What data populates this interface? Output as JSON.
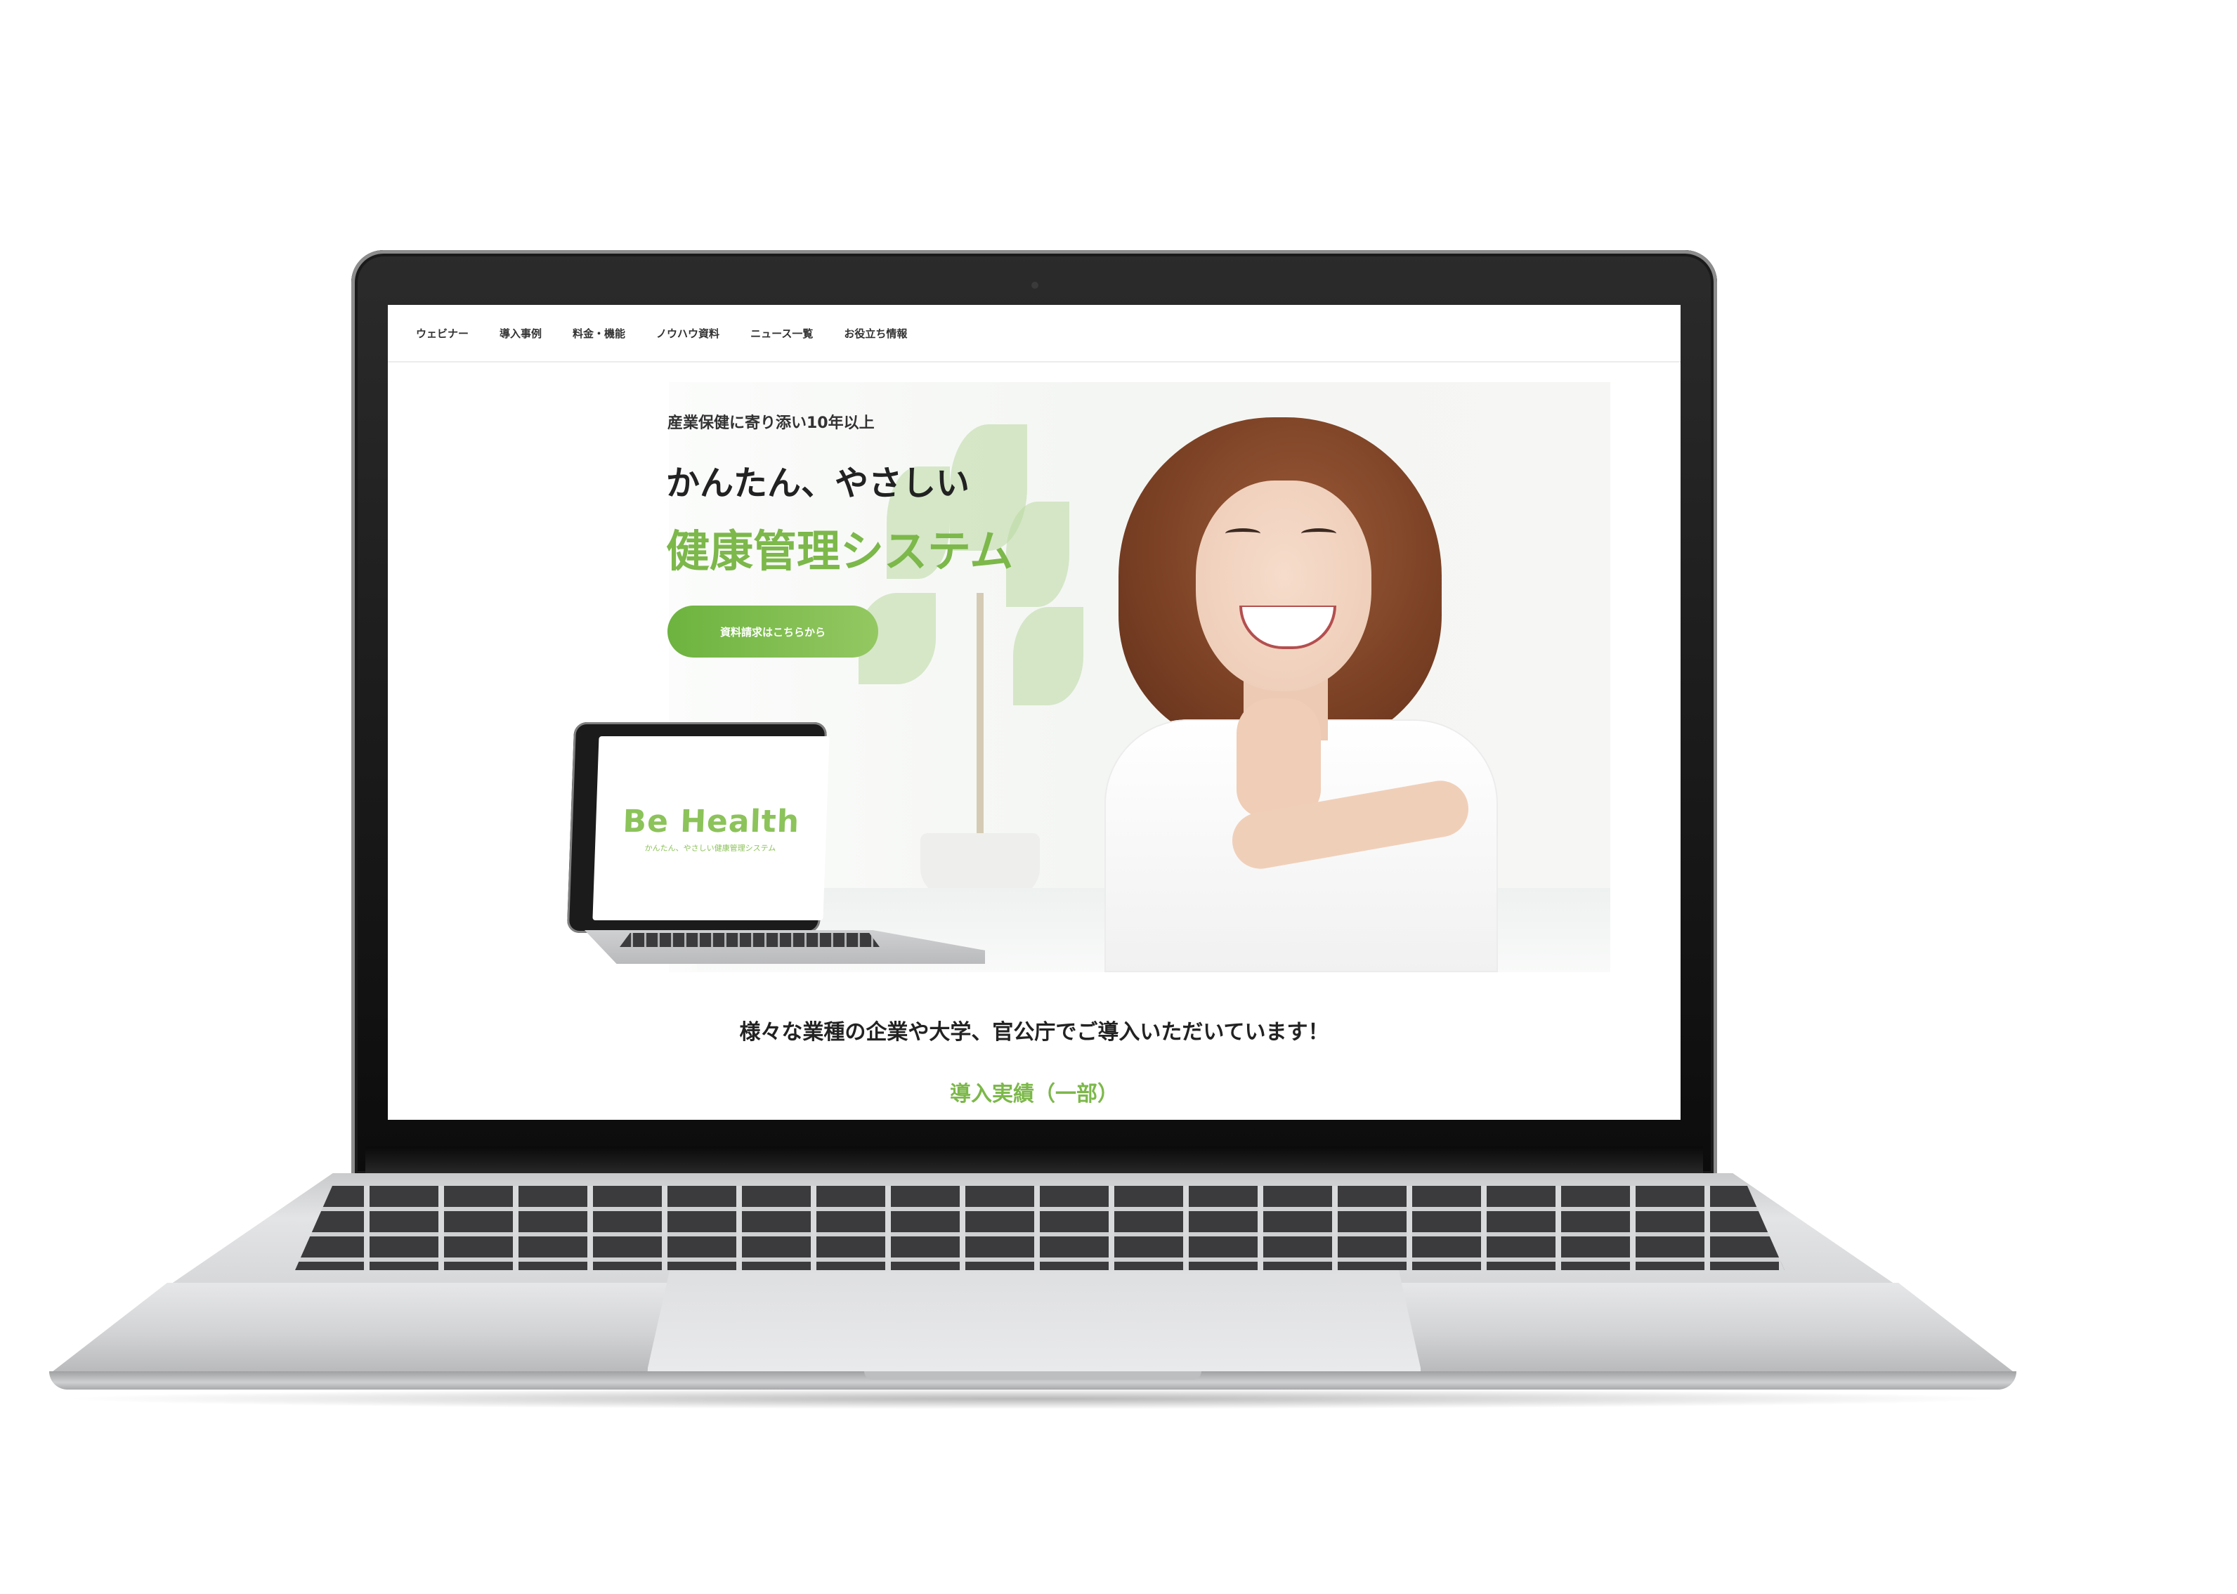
{
  "nav": {
    "items": [
      {
        "label": "ウェビナー"
      },
      {
        "label": "導入事例"
      },
      {
        "label": "料金・機能"
      },
      {
        "label": "ノウハウ資料"
      },
      {
        "label": "ニュース一覧"
      },
      {
        "label": "お役立ち情報"
      }
    ]
  },
  "hero": {
    "eyebrow": "産業保健に寄り添い10年以上",
    "headline": "かんたん、やさしい",
    "headline_accent": "健康管理システム",
    "cta_label": "資料請求はこちらから",
    "logo_text": "Be Health",
    "logo_tagline": "かんたん、やさしい健康管理システム"
  },
  "clients": {
    "title": "様々な業種の企業や大学、官公庁でご導入いただいています！",
    "subtitle": "導入実績（一部）"
  },
  "colors": {
    "accent": "#7cb84a",
    "text": "#222222"
  }
}
